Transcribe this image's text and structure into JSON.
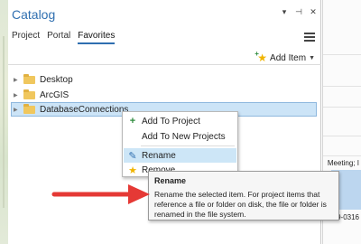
{
  "catalog": {
    "title": "Catalog",
    "title_buttons": [
      "▾",
      "⊣",
      "✕"
    ],
    "tabs": [
      {
        "label": "Project",
        "active": false
      },
      {
        "label": "Portal",
        "active": false
      },
      {
        "label": "Favorites",
        "active": true
      }
    ],
    "add_item_label": "Add Item",
    "tree": [
      {
        "label": "Desktop",
        "selected": false
      },
      {
        "label": "ArcGIS",
        "selected": false
      },
      {
        "label": "DatabaseConnections",
        "selected": true
      }
    ]
  },
  "context_menu": {
    "items": [
      {
        "label": "Add To Project",
        "icon": "plus-icon"
      },
      {
        "label": "Add To New Projects",
        "icon": "none"
      },
      {
        "label": "Rename",
        "icon": "pencil-icon",
        "hovered": true
      },
      {
        "label": "Remove",
        "icon": "remove-star-icon"
      }
    ]
  },
  "tooltip": {
    "title": "Rename",
    "body": "Rename the selected item. For project items that reference a file or folder on disk, the file or folder is renamed in the file system."
  },
  "background": {
    "cells": [
      "Meeting; I",
      "9-0316"
    ]
  },
  "colors": {
    "accent": "#2f6fb0",
    "selection": "#cce4f7",
    "menu_hover": "#cde6f7",
    "arrow": "#e53935",
    "folder": "#f0c75e"
  }
}
